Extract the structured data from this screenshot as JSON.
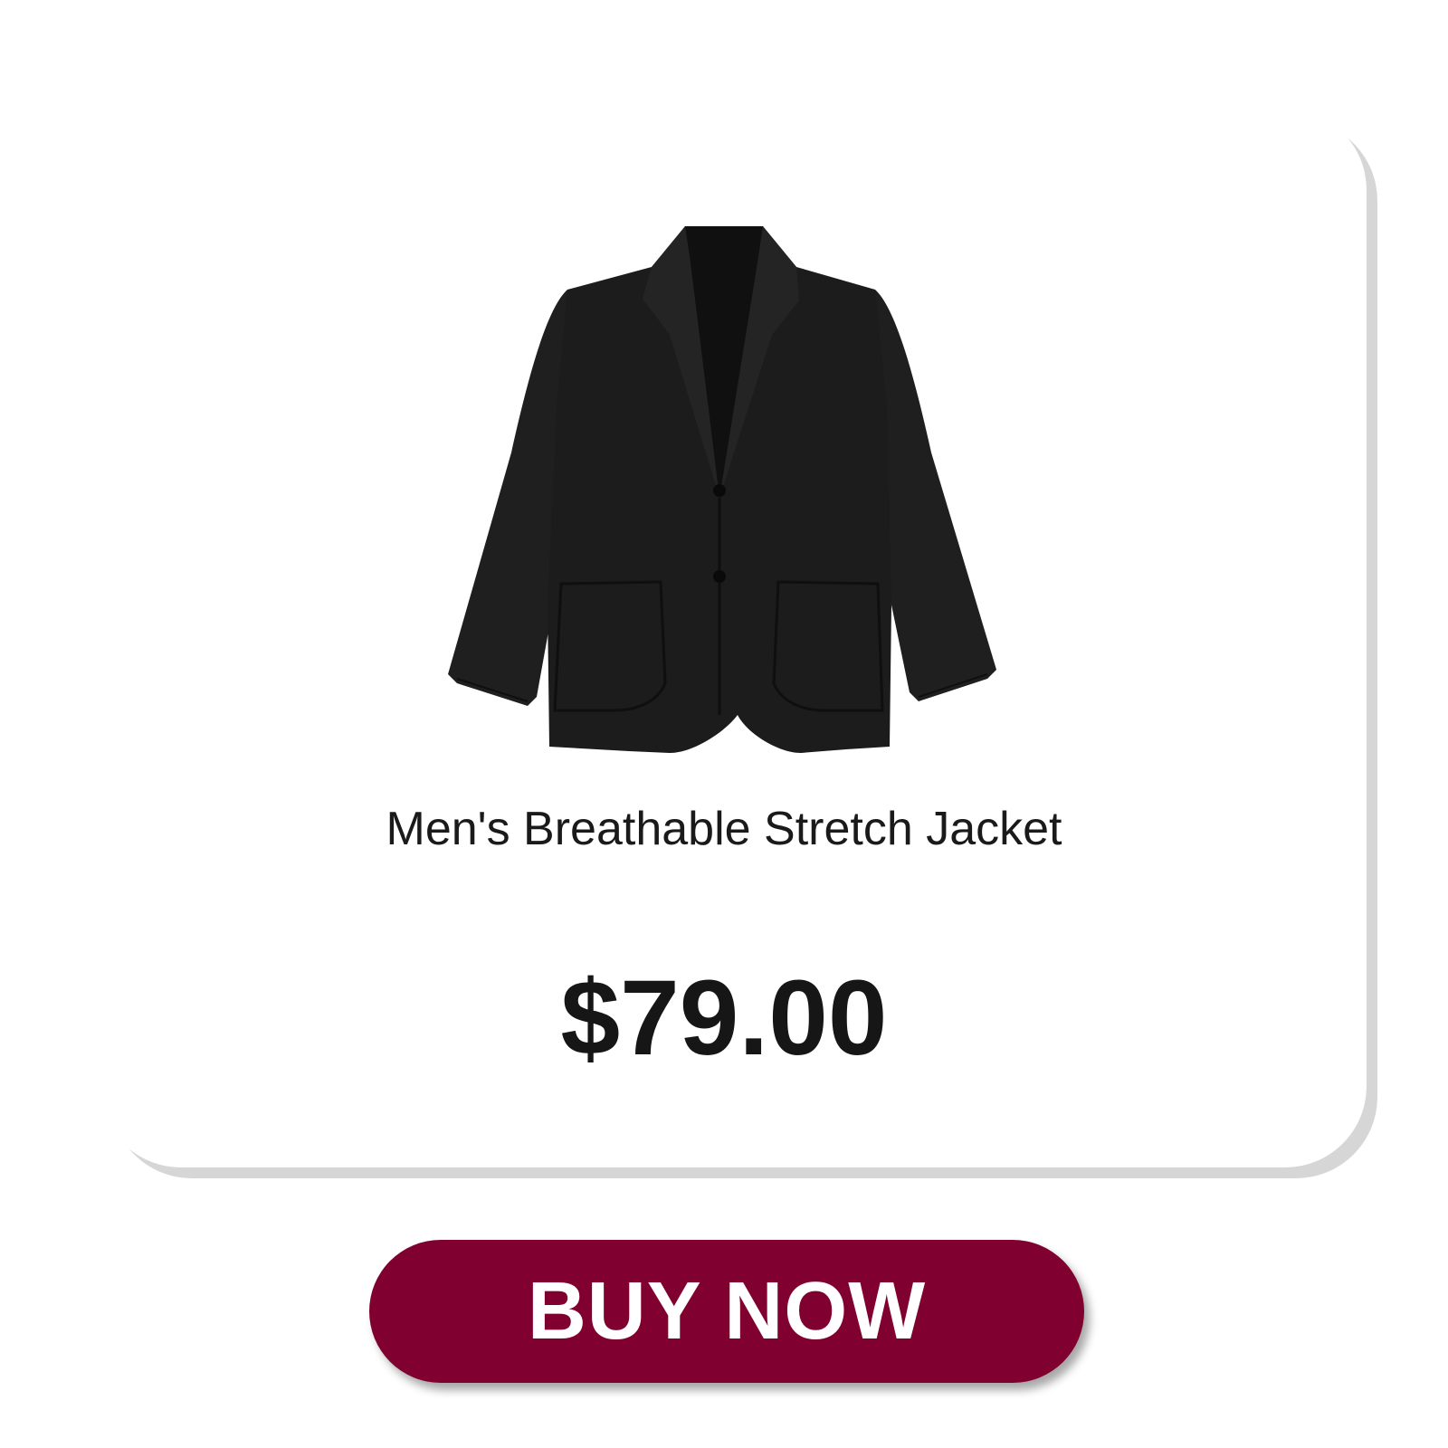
{
  "product": {
    "name": "Men's Breathable Stretch Jacket",
    "price": "$79.00",
    "image_icon": "black-blazer-jacket-image",
    "image_color": "#1c1c1c"
  },
  "cta": {
    "label": "BUY NOW",
    "color": "#800030",
    "text_color": "#ffffff"
  },
  "card": {
    "background": "#ffffff",
    "shadow_color": "#d6d6d6"
  }
}
